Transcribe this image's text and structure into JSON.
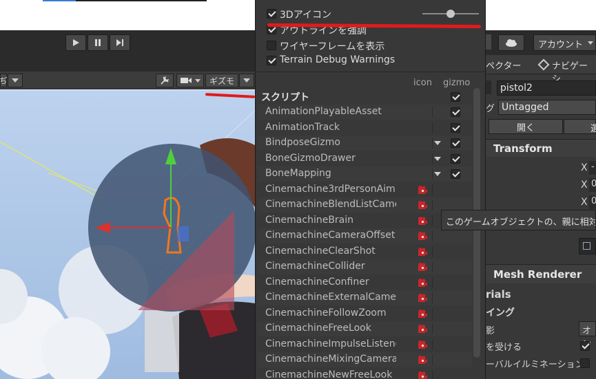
{
  "popup": {
    "options": [
      {
        "label": "3Dアイコン",
        "checked": true
      },
      {
        "label": "アウトラインを強調",
        "checked": true
      },
      {
        "label": "ワイヤーフレームを表示",
        "checked": false
      },
      {
        "label": "Terrain Debug Warnings",
        "checked": true
      }
    ],
    "col_icon": "icon",
    "col_gizmo": "gizmo",
    "section_title": "スクリプト",
    "rows": [
      {
        "name": "AnimationPlayableAsset",
        "arrow": false,
        "icon": false,
        "gizmo": true
      },
      {
        "name": "AnimationTrack",
        "arrow": false,
        "icon": false,
        "gizmo": true
      },
      {
        "name": "BindposeGizmo",
        "arrow": true,
        "icon": false,
        "gizmo": true
      },
      {
        "name": "BoneGizmoDrawer",
        "arrow": true,
        "icon": false,
        "gizmo": true
      },
      {
        "name": "BoneMapping",
        "arrow": true,
        "icon": false,
        "gizmo": true
      },
      {
        "name": "Cinemachine3rdPersonAim",
        "arrow": false,
        "icon": true,
        "gizmo": false
      },
      {
        "name": "CinemachineBlendListCamera",
        "arrow": false,
        "icon": true,
        "gizmo": false
      },
      {
        "name": "CinemachineBrain",
        "arrow": false,
        "icon": true,
        "gizmo": false
      },
      {
        "name": "CinemachineCameraOffset",
        "arrow": false,
        "icon": true,
        "gizmo": false
      },
      {
        "name": "CinemachineClearShot",
        "arrow": false,
        "icon": true,
        "gizmo": false
      },
      {
        "name": "CinemachineCollider",
        "arrow": false,
        "icon": true,
        "gizmo": false
      },
      {
        "name": "CinemachineConfiner",
        "arrow": false,
        "icon": true,
        "gizmo": false
      },
      {
        "name": "CinemachineExternalCamera",
        "arrow": false,
        "icon": true,
        "gizmo": false
      },
      {
        "name": "CinemachineFollowZoom",
        "arrow": false,
        "icon": true,
        "gizmo": false
      },
      {
        "name": "CinemachineFreeLook",
        "arrow": false,
        "icon": true,
        "gizmo": false
      },
      {
        "name": "CinemachineImpulseListener",
        "arrow": false,
        "icon": true,
        "gizmo": false
      },
      {
        "name": "CinemachineMixingCamera",
        "arrow": false,
        "icon": true,
        "gizmo": false
      },
      {
        "name": "CinemachineNewFreeLook",
        "arrow": false,
        "icon": true,
        "gizmo": false
      }
    ],
    "icon_scale": 0.5
  },
  "scene_toolbar": {
    "gizmo_label": "ギズモ"
  },
  "inspector": {
    "account_label": "アカウント",
    "tab_inspector": "ペクター",
    "tab_navigation": "ナビゲーシ",
    "object_name": "pistol2",
    "tag_label": "グ",
    "tag_value": "Untagged",
    "open_button": "開く",
    "select_button": "選",
    "transform_title": "Transform",
    "axis_x1": "X",
    "val1": "-",
    "axis_x2": "X",
    "val2": "0",
    "axis_x3": "X",
    "val3": "0",
    "mesh_renderer_title": "Mesh Renderer",
    "materials_label": "rials",
    "lighting_label": "イング",
    "shadow_label": "影",
    "shadow_value": "オン",
    "receive_shadows_label": "を受ける",
    "gi_label": "ーバルイルミネーション"
  },
  "tooltip": "このゲームオブジェクトの、親に相対的",
  "colors": {
    "annotation_red": "#e11b1b",
    "panel_bg": "#383838",
    "sky": "#b4cbe8"
  }
}
